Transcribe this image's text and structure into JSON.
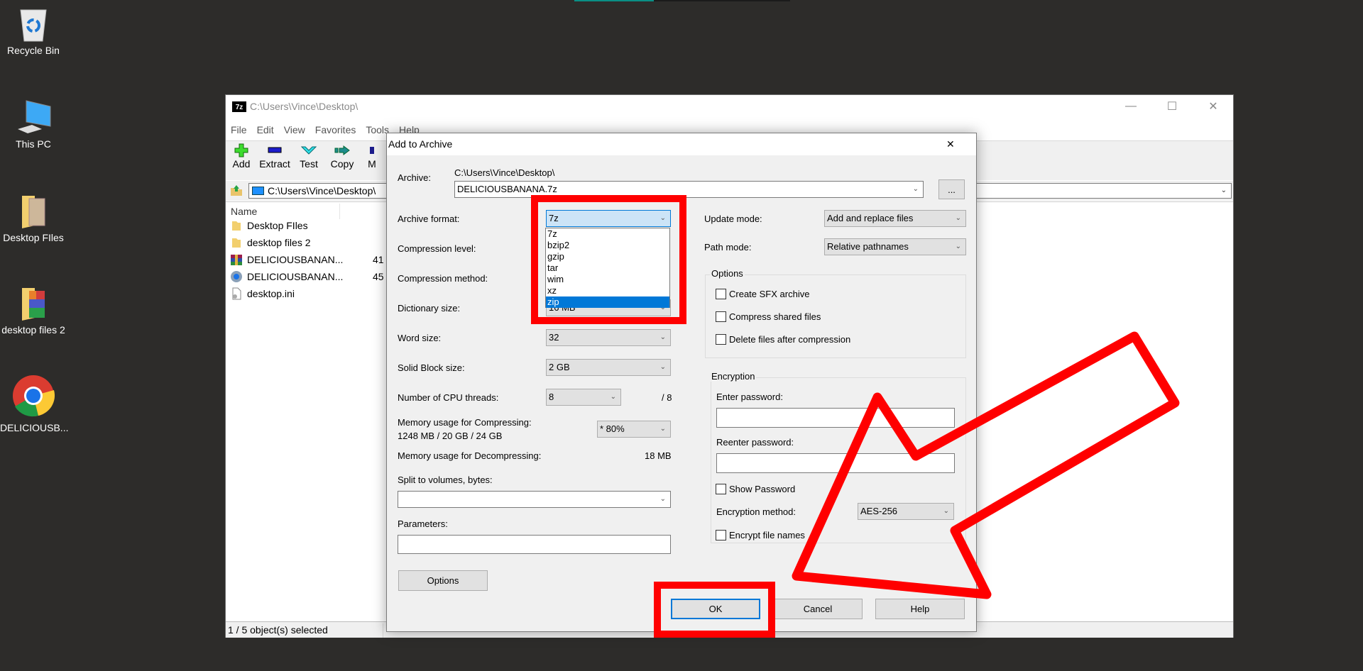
{
  "top_progress": {
    "percent": 37
  },
  "desktop": {
    "icons": [
      {
        "label": "Recycle Bin",
        "icon": "recycle-bin-icon"
      },
      {
        "label": "This PC",
        "icon": "computer-icon"
      },
      {
        "label": "Desktop FIles",
        "icon": "folder-icon"
      },
      {
        "label": "desktop files 2",
        "icon": "folder-icon"
      },
      {
        "label": "DELICIOUSB...",
        "icon": "chrome-icon"
      }
    ]
  },
  "main_window": {
    "title": "C:\\Users\\Vince\\Desktop\\",
    "app_icon": "7z",
    "menu": [
      "File",
      "Edit",
      "View",
      "Favorites",
      "Tools",
      "Help"
    ],
    "toolbar": [
      {
        "label": "Add",
        "icon": "add-icon"
      },
      {
        "label": "Extract",
        "icon": "extract-icon"
      },
      {
        "label": "Test",
        "icon": "test-icon"
      },
      {
        "label": "Copy",
        "icon": "copy-icon"
      },
      {
        "label": "M",
        "icon": "move-icon"
      }
    ],
    "address": "C:\\Users\\Vince\\Desktop\\",
    "column_name": "Name",
    "files": [
      {
        "name": "Desktop FIles",
        "size": "",
        "icon": "folder-icon"
      },
      {
        "name": "desktop files 2",
        "size": "",
        "icon": "folder-icon"
      },
      {
        "name": "DELICIOUSBANAN...",
        "size": "41",
        "icon": "winrar-archive-icon"
      },
      {
        "name": "DELICIOUSBANAN...",
        "size": "45",
        "icon": "chrome-file-icon"
      },
      {
        "name": "desktop.ini",
        "size": "",
        "icon": "settings-file-icon"
      }
    ],
    "status": "1 / 5 object(s) selected"
  },
  "dialog": {
    "title": "Add to Archive",
    "archive_label": "Archive:",
    "archive_dir": "C:\\Users\\Vince\\Desktop\\",
    "archive_name": "DELICIOUSBANANA.7z",
    "browse_label": "...",
    "left": {
      "archive_format_label": "Archive format:",
      "archive_format_value": "7z",
      "compression_level_label": "Compression level:",
      "compression_method_label": "Compression method:",
      "dictionary_size_label": "Dictionary size:",
      "dictionary_size_value": "16 MB",
      "word_size_label": "Word size:",
      "word_size_value": "32",
      "solid_block_label": "Solid Block size:",
      "solid_block_value": "2 GB",
      "cpu_threads_label": "Number of CPU threads:",
      "cpu_threads_value": "8",
      "cpu_threads_max": "/ 8",
      "mem_compress_label": "Memory usage for Compressing:",
      "mem_compress_detail": "1248 MB / 20 GB / 24 GB",
      "mem_compress_value": "* 80%",
      "mem_decompress_label": "Memory usage for Decompressing:",
      "mem_decompress_value": "18 MB",
      "split_label": "Split to volumes, bytes:",
      "split_value": "",
      "parameters_label": "Parameters:",
      "parameters_value": "",
      "options_button": "Options"
    },
    "format_options": [
      "7z",
      "bzip2",
      "gzip",
      "tar",
      "wim",
      "xz",
      "zip"
    ],
    "format_highlighted": "zip",
    "right": {
      "update_mode_label": "Update mode:",
      "update_mode_value": "Add and replace files",
      "path_mode_label": "Path mode:",
      "path_mode_value": "Relative pathnames",
      "options_group": "Options",
      "options": [
        {
          "label": "Create SFX archive",
          "checked": false
        },
        {
          "label": "Compress shared files",
          "checked": false
        },
        {
          "label": "Delete files after compression",
          "checked": false
        }
      ],
      "encryption_group": "Encryption",
      "enter_password_label": "Enter password:",
      "reenter_password_label": "Reenter password:",
      "show_password_label": "Show Password",
      "encryption_method_label": "Encryption method:",
      "encryption_method_value": "AES-256",
      "encrypt_names_label": "Encrypt file names"
    },
    "buttons": {
      "ok": "OK",
      "cancel": "Cancel",
      "help": "Help"
    }
  },
  "annotation_color": "#ff0000"
}
